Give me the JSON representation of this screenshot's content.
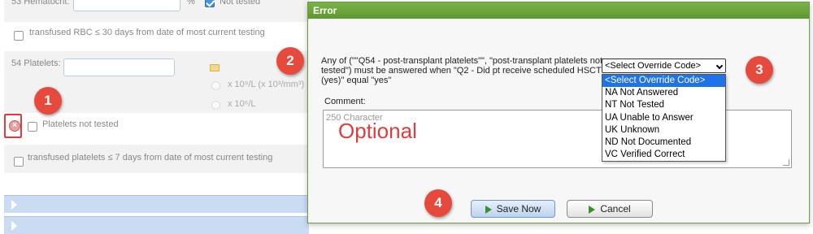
{
  "background": {
    "hematocrit_label": "53 Hematocrit:",
    "percent_unit": "%",
    "hct_not_tested": "Not tested",
    "transfused_rbc": "transfused RBC ≤ 30 days from date of most current testing",
    "platelets_label": "54 Platelets:",
    "unit_option_1": "x 10⁹/L (x 10³/mm³)",
    "unit_option_2": "x 10⁶/L",
    "platelets_not_tested": "Platelets not tested",
    "transfused_platelets": "transfused platelets ≤ 7 days from date of most current testing"
  },
  "dialog": {
    "title": "Error",
    "message": "Any of (\"\"Q54 - post-transplant platelets\"\", \"post-transplant platelets not tested\") must be answered when \"Q2 - Did pt receive scheduled HSCT (yes)\" equal \"yes\"",
    "select_value": "<Select Override Code>",
    "options": [
      "<Select Override Code>",
      "NA Not Answered",
      "NT Not Tested",
      "UA Unable to Answer",
      "UK Unknown",
      "ND Not Documented",
      "VC Verified Correct"
    ],
    "comment_label": "Comment:",
    "comment_placeholder": "250 Character",
    "optional_annotation": "Optional",
    "save_label": "Save Now",
    "cancel_label": "Cancel"
  },
  "callouts": [
    "1",
    "2",
    "3",
    "4"
  ],
  "colors": {
    "title_bar": "#5e9631",
    "callout": "#e64a3c",
    "selected_option": "#1e73e8",
    "annotation_red": "#e23b3b"
  }
}
